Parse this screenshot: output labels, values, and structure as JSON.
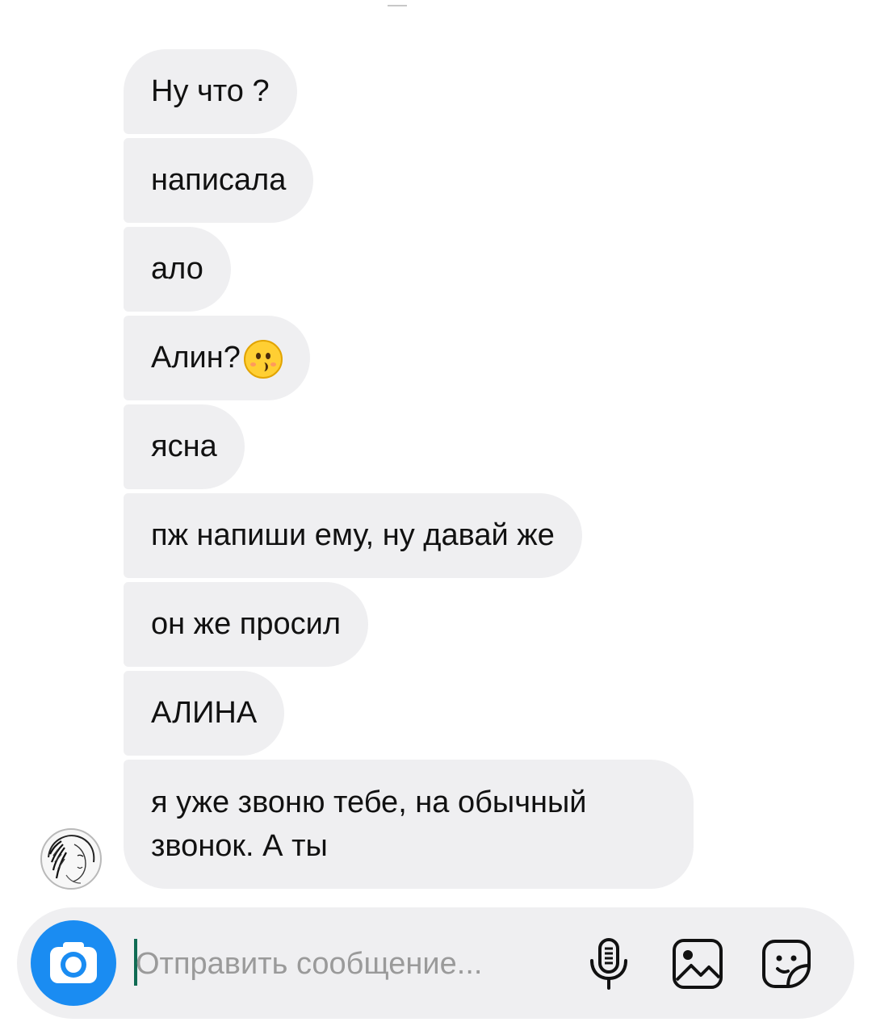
{
  "thread": {
    "messages": [
      "Ну что ?",
      "написала",
      "ало",
      "Алин?",
      "ясна",
      "пж напиши ему, ну давай же",
      "он же просил",
      "АЛИНА",
      "я уже звоню тебе, на обычный звонок. А ты"
    ],
    "emoji_after_message_4": "kissing-face-emoji"
  },
  "composer": {
    "placeholder": "Отправить сообщение...",
    "value": "",
    "icons": {
      "camera": "camera-icon",
      "mic": "microphone-icon",
      "gallery": "gallery-icon",
      "sticker": "sticker-icon"
    }
  },
  "colors": {
    "bubble": "#efeff1",
    "camera_button": "#1a8cf2",
    "placeholder": "#9a9a9a",
    "caret": "#0f6b53"
  }
}
